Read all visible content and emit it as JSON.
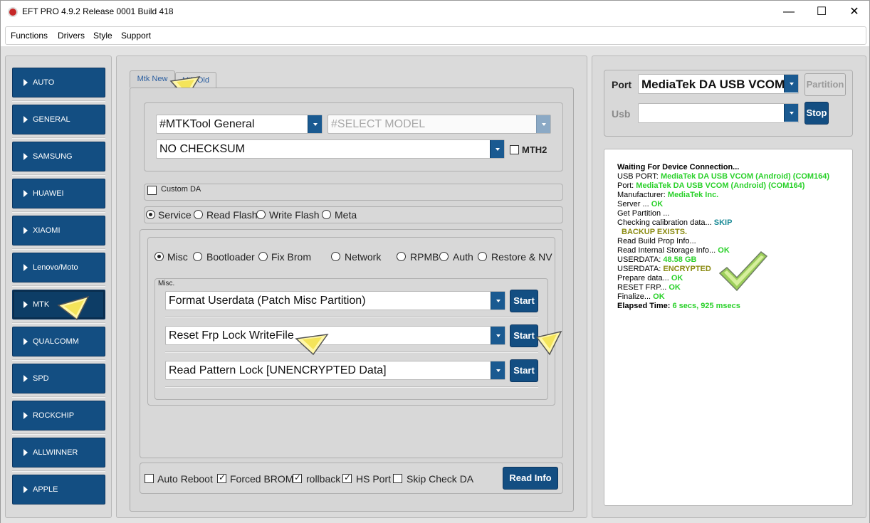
{
  "window": {
    "title": "EFT PRO 4.9.2 Release 0001 Build 418"
  },
  "menu": [
    "Functions",
    "Drivers",
    "Style",
    "Support"
  ],
  "sidebar": {
    "items": [
      {
        "label": "AUTO"
      },
      {
        "label": "GENERAL"
      },
      {
        "label": "SAMSUNG"
      },
      {
        "label": "HUAWEI"
      },
      {
        "label": "XIAOMI"
      },
      {
        "label": "Lenovo/Moto"
      },
      {
        "label": "MTK"
      },
      {
        "label": "QUALCOMM"
      },
      {
        "label": "SPD"
      },
      {
        "label": "ROCKCHIP"
      },
      {
        "label": "ALLWINNER"
      },
      {
        "label": "APPLE"
      }
    ],
    "active": "MTK"
  },
  "tabs": {
    "new": "Mtk New",
    "old": "Mtk Old"
  },
  "model": {
    "tool_combo": "#MTKTool General",
    "model_combo": "#SELECT MODEL",
    "checksum_combo": "NO CHECKSUM",
    "mth2_label": "MTH2"
  },
  "custom_da": {
    "label": "Custom DA"
  },
  "mode": {
    "options": [
      "Service",
      "Read Flash",
      "Write Flash",
      "Meta"
    ],
    "selected": "Service"
  },
  "service_tabs": {
    "options": [
      "Misc",
      "Bootloader",
      "Fix Brom",
      "Network",
      "RPMB",
      "Auth",
      "Restore & NV"
    ],
    "selected": "Misc"
  },
  "misc": {
    "group_label": "Misc.",
    "rows": [
      {
        "action": "Format Userdata (Patch Misc Partition)",
        "button": "Start"
      },
      {
        "action": "Reset Frp Lock WriteFile",
        "button": "Start"
      },
      {
        "action": "Read Pattern Lock [UNENCRYPTED Data]",
        "button": "Start"
      }
    ]
  },
  "bottom": {
    "auto_reboot": "Auto Reboot",
    "forced_brom": "Forced BROM",
    "rollback": "rollback",
    "hs_port": "HS Port",
    "skip_check_da": "Skip Check DA",
    "read_info": "Read Info"
  },
  "connection": {
    "port_label": "Port",
    "port_value": "MediaTek DA USB VCOM",
    "partition_button": "Partition",
    "usb_label": "Usb",
    "usb_value": "",
    "stop_button": "Stop"
  },
  "log": [
    {
      "k": "Waiting For Device Connection...",
      "v": "",
      "style": "bold"
    },
    {
      "k": "USB PORT: ",
      "v": "MediaTek DA USB VCOM (Android) (COM164)",
      "style": "green"
    },
    {
      "k": "Port: ",
      "v": "MediaTek DA USB VCOM (Android) (COM164)",
      "style": "green"
    },
    {
      "k": "Manufacturer: ",
      "v": "MediaTek Inc.",
      "style": "green"
    },
    {
      "k": "Server ... ",
      "v": "OK",
      "style": "green"
    },
    {
      "k": "Get Partition ...",
      "v": "",
      "style": "plain"
    },
    {
      "k": "Checking calibration data... ",
      "v": "SKIP",
      "style": "teal"
    },
    {
      "k": "",
      "v": "BACKUP EXISTS.",
      "style": "olive"
    },
    {
      "k": "Read Build Prop Info...",
      "v": "",
      "style": "plain"
    },
    {
      "k": "Read Internal Storage Info... ",
      "v": "OK",
      "style": "green"
    },
    {
      "k": "USERDATA: ",
      "v": "48.58 GB",
      "style": "green"
    },
    {
      "k": "USERDATA: ",
      "v": "ENCRYPTED",
      "style": "olive"
    },
    {
      "k": "Prepare data... ",
      "v": "OK",
      "style": "green"
    },
    {
      "k": "RESET FRP... ",
      "v": "OK",
      "style": "green"
    },
    {
      "k": "Finalize... ",
      "v": "OK",
      "style": "green"
    },
    {
      "k": "Elapsed Time: ",
      "v": "6 secs, 925 msecs",
      "style": "green-boldkey"
    }
  ],
  "colors": {
    "nav_button": "#134e82",
    "ok_green": "#2ad12a",
    "skip_teal": "#1a8a96",
    "warn_olive": "#8a8a10",
    "check_mark": "#7bc043"
  },
  "icons": {
    "check": "checkmark-icon",
    "pointer": "pointer-arrow-icon"
  }
}
